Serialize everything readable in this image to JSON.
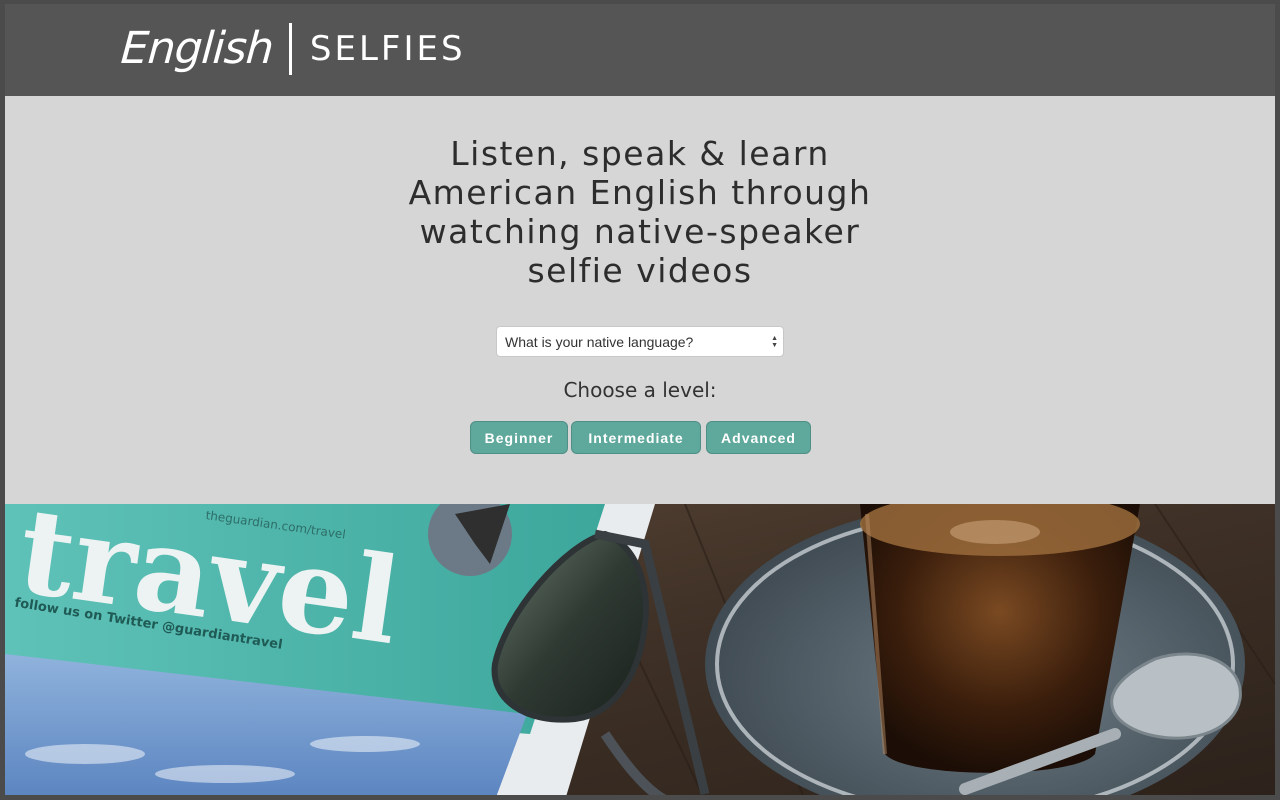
{
  "header": {
    "logo_word": "English",
    "logo_tagline": "SELFIES"
  },
  "hero": {
    "headline_lines": [
      "Listen, speak & learn",
      "American English through",
      "watching native-speaker",
      "selfie videos"
    ],
    "language_select": {
      "selected": "What is your native language?"
    },
    "choose_level_label": "Choose a level:",
    "levels": [
      {
        "label": "Beginner"
      },
      {
        "label": "Intermediate"
      },
      {
        "label": "Advanced"
      }
    ]
  },
  "photo": {
    "newspaper_masthead": "travel",
    "newspaper_url": "theguardian.com/travel",
    "newspaper_follow": "follow us on Twitter @guardiantravel"
  },
  "colors": {
    "header_bg": "#555555",
    "hero_bg": "#d6d6d6",
    "button_bg": "#5fa89c"
  }
}
